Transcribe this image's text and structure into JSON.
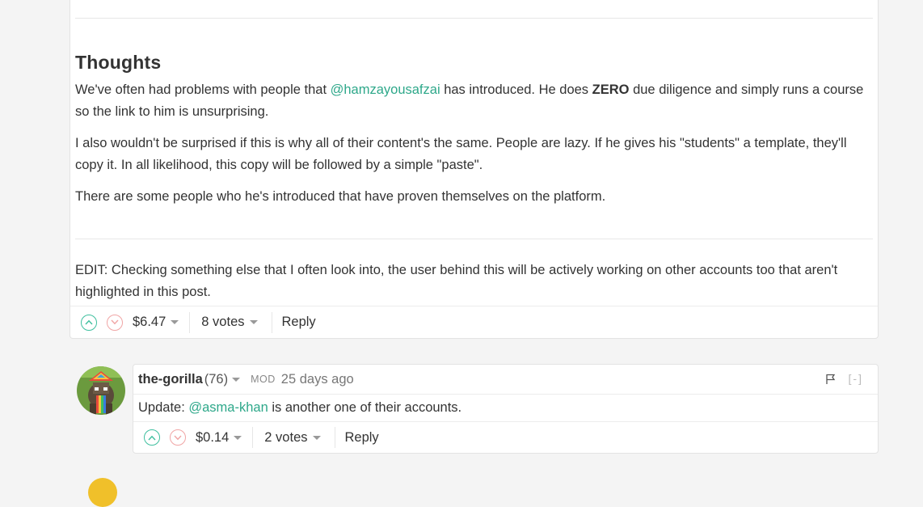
{
  "post": {
    "heading": "Thoughts",
    "p1_before": "We've often had problems with people that ",
    "p1_mention": "@hamzayousafzai",
    "p1_middle": " has introduced. He does ",
    "p1_strong": "ZERO",
    "p1_after": " due diligence and simply runs a course so the link to him is unsurprising.",
    "p2": "I also wouldn't be surprised if this is why all of their content's the same. People are lazy. If he gives his \"students\" a template, they'll copy it. In all likelihood, this copy will be followed by a simple \"paste\".",
    "p3": "There are some people who he's introduced that have proven themselves on the platform.",
    "edit": "EDIT: Checking something else that I often look into, the user behind this will be actively working on other accounts too that aren't highlighted in this post.",
    "footer": {
      "payout": "$6.47",
      "votes": "8 votes",
      "reply": "Reply"
    }
  },
  "comment": {
    "author": "the-gorilla",
    "reputation": "(76)",
    "badge": "MOD",
    "time": "25 days ago",
    "collapse": "[-]",
    "text_before": "Update: ",
    "text_mention": "@asma-khan",
    "text_after": " is another one of their accounts.",
    "footer": {
      "payout": "$0.14",
      "votes": "2 votes",
      "reply": "Reply"
    }
  },
  "icons": {
    "upvote": "chevron-up-icon",
    "downvote": "chevron-down-icon",
    "flag": "flag-icon"
  },
  "colors": {
    "mention": "#2ea88a",
    "upvote": "#3fbf9f",
    "downvote": "#f0a5a5"
  }
}
